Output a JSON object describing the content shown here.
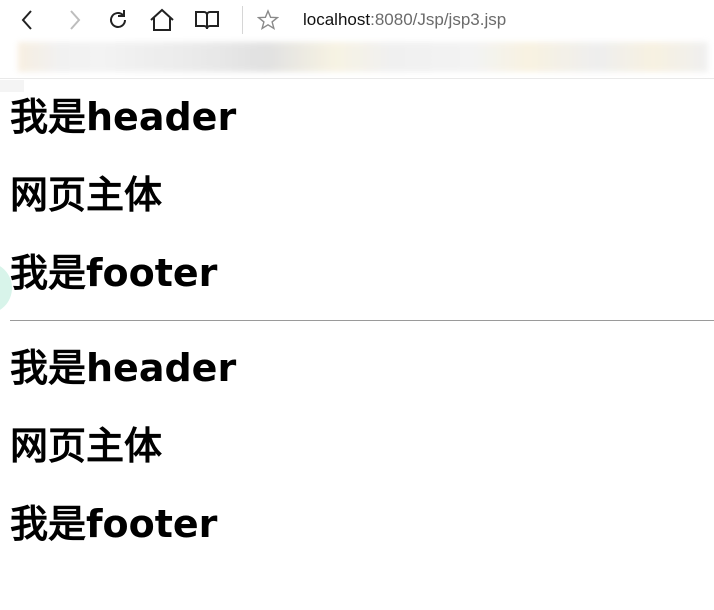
{
  "browser": {
    "address": {
      "host": "localhost",
      "path": ":8080/Jsp/jsp3.jsp"
    },
    "toolbar": {
      "back_icon": "chevron-left-icon",
      "forward_icon": "chevron-right-icon",
      "refresh_icon": "refresh-icon",
      "home_icon": "home-icon",
      "reading_icon": "book-icon",
      "favorite_icon": "star-icon"
    }
  },
  "page": {
    "sections": [
      {
        "header": "我是header",
        "body": "网页主体",
        "footer": "我是footer"
      },
      {
        "header": "我是header",
        "body": "网页主体",
        "footer": "我是footer"
      }
    ]
  }
}
